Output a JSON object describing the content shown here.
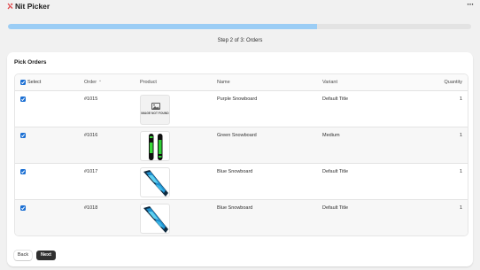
{
  "app": {
    "title": "Nit Picker",
    "more_label": "···"
  },
  "progress": {
    "percent": 66.7,
    "step_text": "Step 2 of 3: Orders"
  },
  "card": {
    "title": "Pick Orders"
  },
  "table": {
    "columns": {
      "select": "Select",
      "order": "Order",
      "product": "Product",
      "name": "Name",
      "variant": "Variant",
      "quantity": "Quantity"
    },
    "sort_indicator": "⌃",
    "rows": [
      {
        "order": "#1015",
        "product_image": "not-found",
        "image_text": "IMAGE NOT FOUND",
        "name": "Purple Snowboard",
        "variant": "Default Title",
        "quantity": "1",
        "checked": true
      },
      {
        "order": "#1016",
        "product_image": "green-snowboard",
        "name": "Green Snowboard",
        "variant": "Medium",
        "quantity": "1",
        "checked": true
      },
      {
        "order": "#1017",
        "product_image": "blue-snowboard",
        "name": "Blue Snowboard",
        "variant": "Default Title",
        "quantity": "1",
        "checked": true
      },
      {
        "order": "#1018",
        "product_image": "blue-snowboard",
        "name": "Blue Snowboard",
        "variant": "Default Title",
        "quantity": "1",
        "checked": true
      }
    ]
  },
  "buttons": {
    "back": "Back",
    "next": "Next"
  },
  "colors": {
    "accent": "#1b6fd3",
    "progress": "#9bcdf5",
    "primary_button": "#303030"
  }
}
